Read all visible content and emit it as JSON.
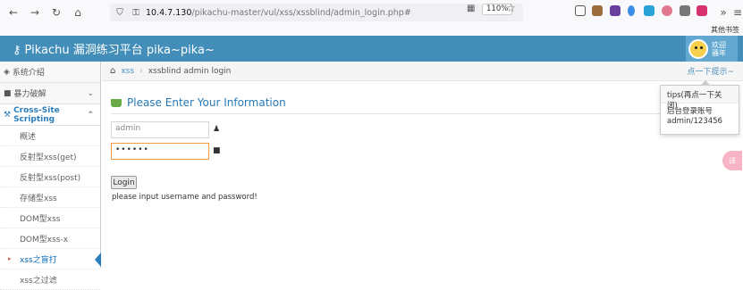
{
  "browser": {
    "url_host": "10.4.7.130",
    "url_path": "/pikachu-master/vul/xss/xssblind/admin_login.php#",
    "zoom": "110%",
    "bookmarks_other": "其他书签"
  },
  "header": {
    "title": "Pikachu 漏洞练习平台 pika~pika~",
    "welcome": "欢迎",
    "username": "骚年"
  },
  "sidebar": {
    "items": [
      {
        "label": "系统介绍"
      },
      {
        "label": "暴力破解"
      },
      {
        "label": "Cross-Site Scripting"
      }
    ],
    "sub_items": [
      {
        "label": "概述"
      },
      {
        "label": "反射型xss(get)"
      },
      {
        "label": "反射型xss(post)"
      },
      {
        "label": "存储型xss"
      },
      {
        "label": "DOM型xss"
      },
      {
        "label": "DOM型xss-x"
      },
      {
        "label": "xss之盲打"
      },
      {
        "label": "xss之过滤"
      }
    ]
  },
  "breadcrumb": {
    "section": "xss",
    "page": "xssblind admin login",
    "tips": "点一下提示~"
  },
  "main": {
    "heading": "Please Enter Your Information",
    "username_value": "admin",
    "password_mask": "••••••",
    "login_label": "Login",
    "hint": "please input username and password!"
  },
  "popover": {
    "title": "tips(再点一下关闭)",
    "line1": "后台登录账号",
    "line2": "admin/123456"
  },
  "float": {
    "label": "译"
  }
}
